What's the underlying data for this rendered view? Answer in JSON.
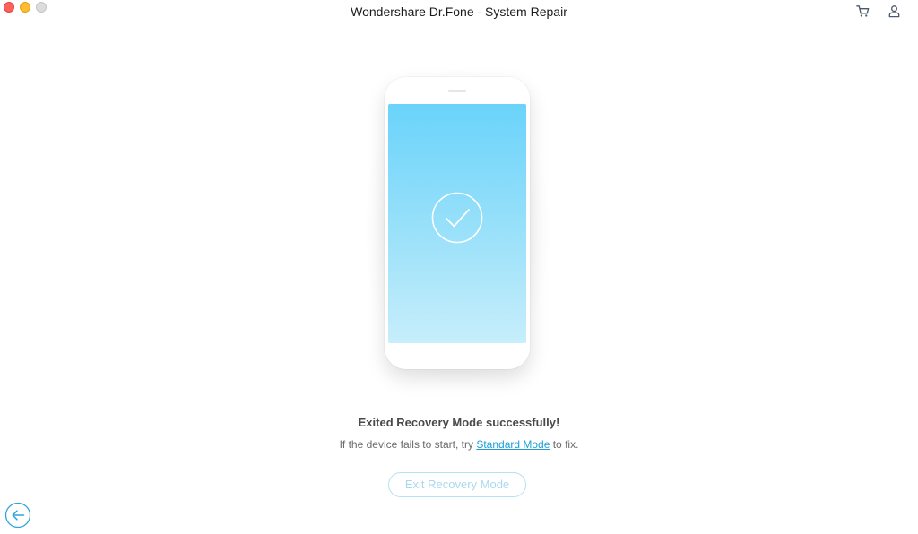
{
  "window": {
    "title": "Wondershare Dr.Fone - System Repair"
  },
  "toolbar": {
    "cart_icon": "cart-icon",
    "account_icon": "user-icon"
  },
  "illustration": {
    "icon": "check-circle-icon",
    "screen_gradient": [
      "#6ad3fa",
      "#c7eefb"
    ]
  },
  "status": {
    "title": "Exited Recovery Mode successfully!",
    "sub_prefix": "If the device fails to start, try ",
    "link_label": "Standard Mode",
    "sub_suffix": " to fix."
  },
  "actions": {
    "exit_label": "Exit Recovery Mode",
    "back_icon": "back-arrow-icon"
  },
  "colors": {
    "accent": "#1a9ed6",
    "disabled_text": "#a9d9ee",
    "close": "#fe5f57",
    "minimize": "#febc2e",
    "zoom": "#dcdcdc"
  }
}
